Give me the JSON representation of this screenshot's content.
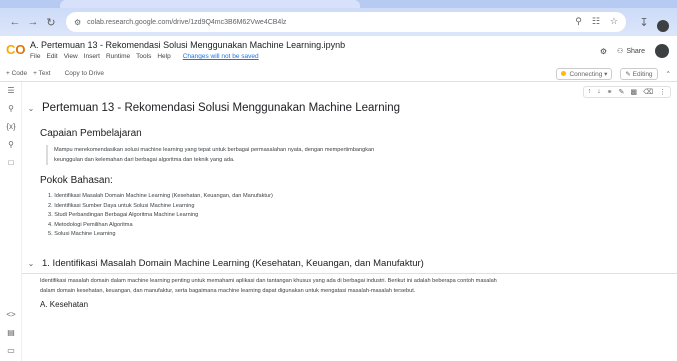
{
  "browser": {
    "url": "colab.research.google.com/drive/1zd9Q4mc3B6M62Vwe4CB4lz"
  },
  "header": {
    "title": "A. Pertemuan 13 - Rekomendasi Solusi Menggunakan Machine Learning.ipynb",
    "menu": [
      "File",
      "Edit",
      "View",
      "Insert",
      "Runtime",
      "Tools",
      "Help"
    ],
    "saved_status": "Changes will not be saved",
    "share_label": "Share"
  },
  "toolbar": {
    "code_label": "+ Code",
    "text_label": "+ Text",
    "copy_label": "Copy to Drive",
    "connect_label": "Connecting",
    "edit_label": "Editing"
  },
  "main": {
    "section1_title": "Pertemuan 13 - Rekomendasi Solusi Menggunakan Machine Learning",
    "capaian_heading": "Capaian Pembelajaran",
    "capaian_text_1": "Mampu merekomendasikan solusi machine learning yang tepat untuk berbagai permasalahan nyata, dengan mempertimbangkan",
    "capaian_text_2": "keunggulan dan kelemahan dari berbagai algoritma dan teknik yang ada.",
    "pokok_heading": "Pokok Bahasan:",
    "pokok_items": [
      "1. Identifikasi Masalah Domain Machine Learning (Kesehatan, Keuangan, dan Manufaktur)",
      "2. Identifikasi Sumber Daya untuk Solusi Machine Learning",
      "3. Studi Perbandingan Berbagai Algoritma Machine Learning",
      "4. Metodologi Pemilihan Algoritma",
      "5. Solusi Machine Learning"
    ],
    "section2_title": "1. Identifikasi Masalah Domain Machine Learning (Kesehatan, Keuangan, dan Manufaktur)",
    "section2_para": "Identifikasi masalah domain dalam machine learning penting untuk memahami aplikasi dan tantangan khusus yang ada di berbagai industri. Berikut ini adalah beberapa contoh masalah dalam domain kesehatan, keuangan, dan manufaktur, serta bagaimana machine learning dapat digunakan untuk mengatasi masalah-masalah tersebut.",
    "sub_heading": "A. Kesehatan"
  }
}
